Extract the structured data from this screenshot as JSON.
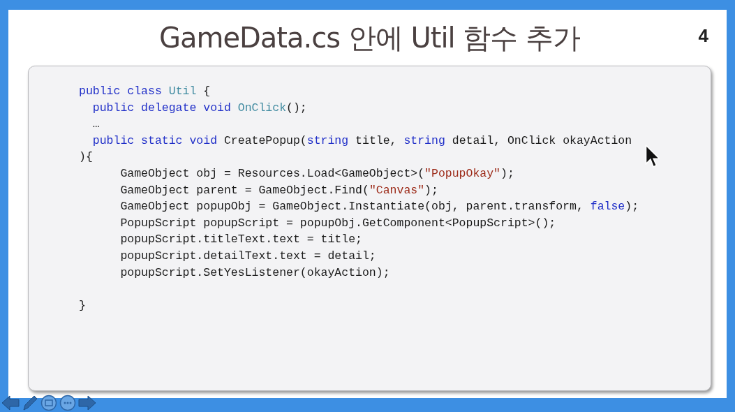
{
  "slide": {
    "title": "GameData.cs 안에 Util 함수 추가",
    "page_number": "4",
    "code_lines": [
      {
        "kind": "code",
        "tokens": [
          {
            "kind": "keyword",
            "text": "public class "
          },
          {
            "kind": "type",
            "text": "Util"
          },
          {
            "kind": "plain",
            "text": " {"
          }
        ]
      },
      {
        "kind": "code",
        "tokens": [
          {
            "kind": "keyword",
            "text": "  public delegate void "
          },
          {
            "kind": "type",
            "text": "OnClick"
          },
          {
            "kind": "plain",
            "text": "();"
          }
        ]
      },
      {
        "kind": "code",
        "tokens": [
          {
            "kind": "plain",
            "text": "  …"
          }
        ]
      },
      {
        "kind": "code",
        "tokens": [
          {
            "kind": "keyword",
            "text": "  public static void "
          },
          {
            "kind": "plain",
            "text": "CreatePopup("
          },
          {
            "kind": "keyword",
            "text": "string"
          },
          {
            "kind": "plain",
            "text": " title, "
          },
          {
            "kind": "keyword",
            "text": "string"
          },
          {
            "kind": "plain",
            "text": " detail, OnClick okayAction"
          }
        ]
      },
      {
        "kind": "code",
        "tokens": [
          {
            "kind": "plain",
            "text": "){"
          }
        ]
      },
      {
        "kind": "code",
        "tokens": [
          {
            "kind": "plain",
            "text": "      GameObject obj = Resources.Load<GameObject>("
          },
          {
            "kind": "string",
            "text": "\"PopupOkay\""
          },
          {
            "kind": "plain",
            "text": ");"
          }
        ]
      },
      {
        "kind": "code",
        "tokens": [
          {
            "kind": "plain",
            "text": "      GameObject parent = GameObject.Find("
          },
          {
            "kind": "string",
            "text": "\"Canvas\""
          },
          {
            "kind": "plain",
            "text": ");"
          }
        ]
      },
      {
        "kind": "code",
        "tokens": [
          {
            "kind": "plain",
            "text": "      GameObject popupObj = GameObject.Instantiate(obj, parent.transform, "
          },
          {
            "kind": "keyword",
            "text": "false"
          },
          {
            "kind": "plain",
            "text": ");"
          }
        ]
      },
      {
        "kind": "code",
        "tokens": [
          {
            "kind": "plain",
            "text": "      PopupScript popupScript = popupObj.GetComponent<PopupScript>();"
          }
        ]
      },
      {
        "kind": "code",
        "tokens": [
          {
            "kind": "plain",
            "text": "      popupScript.titleText.text = title;"
          }
        ]
      },
      {
        "kind": "code",
        "tokens": [
          {
            "kind": "plain",
            "text": "      popupScript.detailText.text = detail;"
          }
        ]
      },
      {
        "kind": "code",
        "tokens": [
          {
            "kind": "plain",
            "text": "      popupScript.SetYesListener(okayAction);"
          }
        ]
      },
      {
        "kind": "blank"
      },
      {
        "kind": "code",
        "tokens": [
          {
            "kind": "plain",
            "text": "}"
          }
        ]
      }
    ]
  }
}
